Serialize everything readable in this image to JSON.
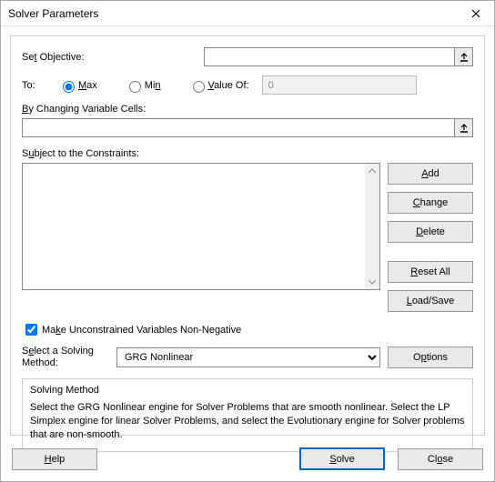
{
  "title": "Solver Parameters",
  "labels": {
    "set_objective": "Set Objective:",
    "to": "To:",
    "max": "Max",
    "min": "Min",
    "value_of": "Value Of:",
    "changing_cells": "By Changing Variable Cells:",
    "constraints": "Subject to the Constraints:",
    "make_unconstrained": "Make Unconstrained Variables Non-Negative",
    "select_method": "Select a Solving Method:",
    "desc_title": "Solving Method",
    "desc_text": "Select the GRG Nonlinear engine for Solver Problems that are smooth nonlinear. Select the LP Simplex engine for linear Solver Problems, and select the Evolutionary engine for Solver problems that are non-smooth."
  },
  "inputs": {
    "objective": "",
    "value_of": "0",
    "changing_cells": "",
    "method_selected": "GRG Nonlinear"
  },
  "buttons": {
    "add": "Add",
    "change": "Change",
    "delete": "Delete",
    "reset_all": "Reset All",
    "load_save": "Load/Save",
    "options": "Options",
    "help": "Help",
    "solve": "Solve",
    "close": "Close"
  },
  "state": {
    "radio_selected": "max",
    "make_unconstrained_checked": true
  }
}
